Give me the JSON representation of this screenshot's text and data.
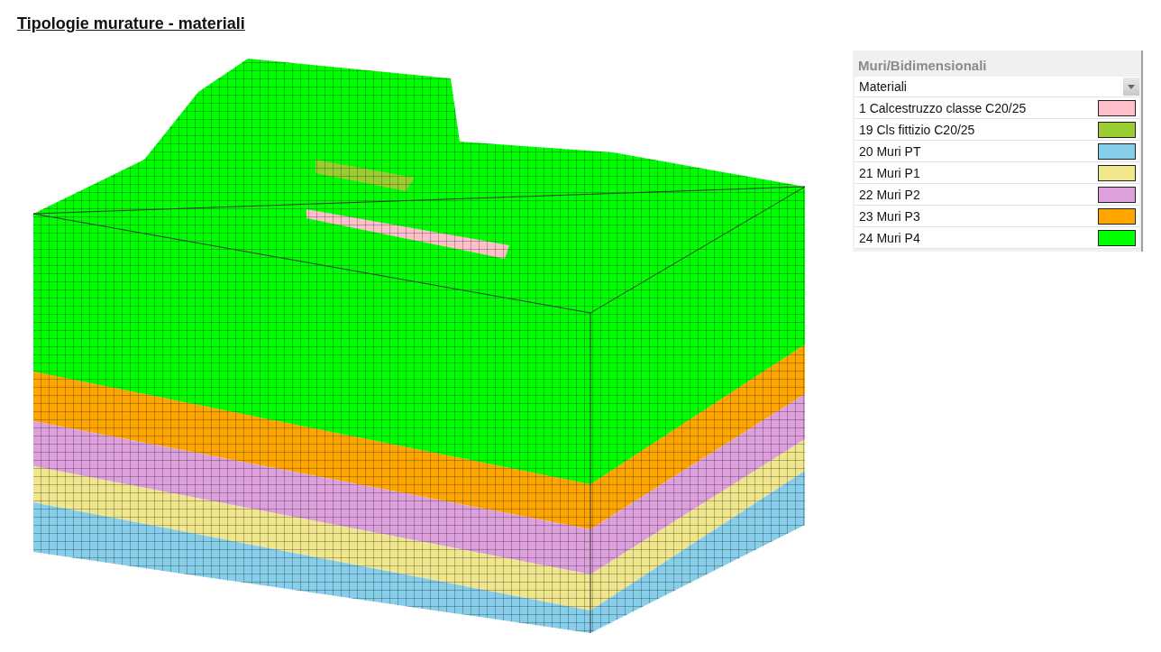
{
  "title": "Tipologie murature - materiali",
  "legend": {
    "title": "Muri/Bidimensionali",
    "dropdown": {
      "value": "Materiali"
    },
    "items": [
      {
        "label": "1 Calcestruzzo classe C20/25",
        "color": "#ffc0cb"
      },
      {
        "label": "19 Cls fittizio C20/25",
        "color": "#9acd32"
      },
      {
        "label": "20 Muri PT",
        "color": "#87ceeb"
      },
      {
        "label": "21 Muri P1",
        "color": "#f0e68c"
      },
      {
        "label": "22 Muri P2",
        "color": "#dda0dd"
      },
      {
        "label": "23 Muri P3",
        "color": "#ffa500"
      },
      {
        "label": "24 Muri P4",
        "color": "#00ff00"
      }
    ]
  }
}
